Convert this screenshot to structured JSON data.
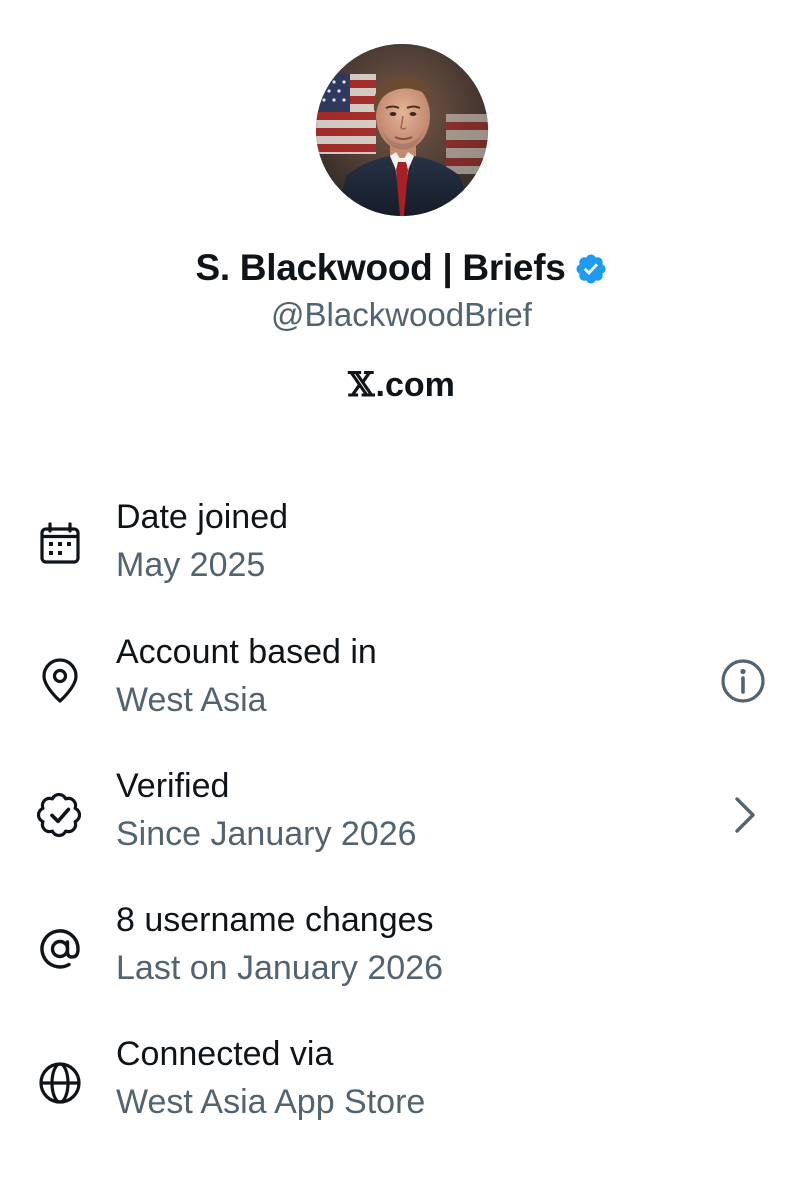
{
  "profile": {
    "display_name": "S. Blackwood | Briefs",
    "handle": "@BlackwoodBrief",
    "site_mark": "𝕏",
    "site_rest": ".com",
    "avatar_icon": "profile-photo",
    "verified_icon": "verified-badge-icon"
  },
  "colors": {
    "primary_text": "#0f1419",
    "secondary_text": "#536471",
    "verified_blue": "#1d9bf0"
  },
  "rows": [
    {
      "icon": "calendar-icon",
      "title": "Date joined",
      "subtitle": "May 2025",
      "trailing_icon": ""
    },
    {
      "icon": "location-pin-icon",
      "title": "Account based in",
      "subtitle": "West Asia",
      "trailing_icon": "info-icon"
    },
    {
      "icon": "verified-outline-icon",
      "title": "Verified",
      "subtitle": "Since January 2026",
      "trailing_icon": "chevron-right-icon"
    },
    {
      "icon": "at-sign-icon",
      "title": "8 username changes",
      "subtitle": "Last on January 2026",
      "trailing_icon": ""
    },
    {
      "icon": "globe-icon",
      "title": "Connected via",
      "subtitle": "West Asia App Store",
      "trailing_icon": ""
    }
  ]
}
